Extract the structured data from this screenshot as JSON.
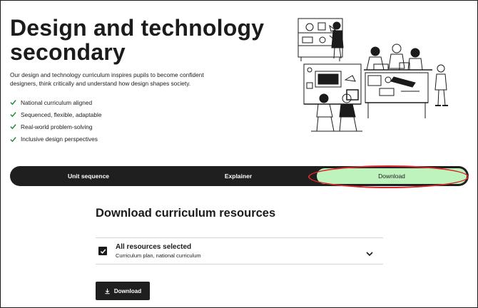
{
  "hero": {
    "title": "Design and technology secondary",
    "intro": "Our design and technology curriculum inspires pupils to become confident designers, think critically and understand how design shapes society.",
    "checklist": [
      "National curriculum aligned",
      "Sequenced, flexible, adaptable",
      "Real-world problem-solving",
      "Inclusive design perspectives"
    ],
    "illustration_icon": "classroom-illustration"
  },
  "tabs": [
    {
      "label": "Unit sequence",
      "active": false
    },
    {
      "label": "Explainer",
      "active": false
    },
    {
      "label": "Download",
      "active": true
    }
  ],
  "download": {
    "heading": "Download curriculum resources",
    "resource_title": "All resources selected",
    "resource_subtitle": "Curriculum plan, national curriculum",
    "checkbox_checked": true,
    "button_label": "Download"
  },
  "colors": {
    "tabbar_bg": "#1f1f1f",
    "active_tab_bg": "#bff3bd",
    "check_icon": "#1e8a3b",
    "annotation": "#d92a2a"
  },
  "icons": {
    "check": "check-icon",
    "chevron": "chevron-down-icon",
    "download": "download-icon"
  }
}
